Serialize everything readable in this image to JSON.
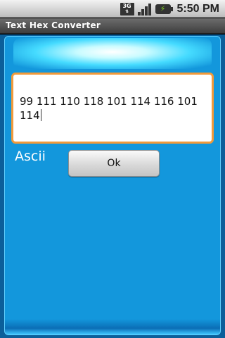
{
  "status_bar": {
    "network_label": "3G",
    "network_icon": "3g-data-icon",
    "signal_icon": "signal-strength-icon",
    "battery_icon": "battery-charging-icon",
    "time": "5:50 PM"
  },
  "title_bar": {
    "title": "Text Hex Converter"
  },
  "main": {
    "input_value": "99 111 110 118 101 114 116 101 114",
    "input_focused": true,
    "mode_label": "Ascii",
    "ok_label": "Ok"
  },
  "colors": {
    "panel_blue": "#1397dc",
    "input_focus_border": "#f29a3a",
    "glow": "#45dbff"
  }
}
